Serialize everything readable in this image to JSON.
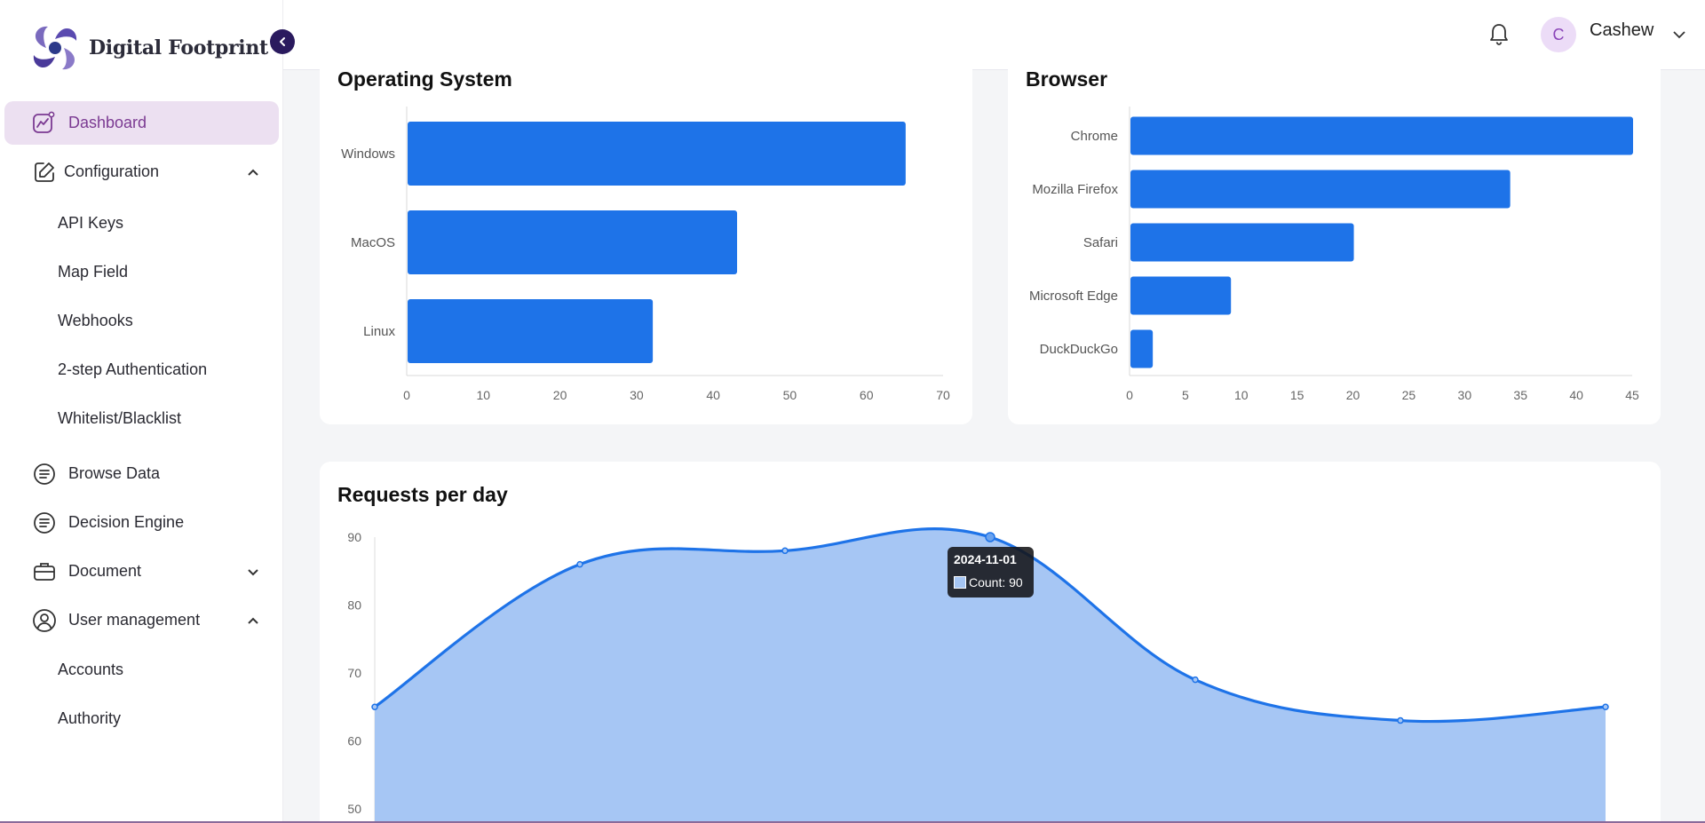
{
  "brand": {
    "name": "Digital Footprint"
  },
  "sidebar": {
    "items": [
      {
        "label": "Dashboard",
        "icon": "chart-line-icon",
        "active": true
      },
      {
        "label": "Configuration",
        "icon": "edit-icon",
        "expanded": true,
        "children": [
          {
            "label": "API Keys"
          },
          {
            "label": "Map Field"
          },
          {
            "label": "Webhooks"
          },
          {
            "label": "2-step Authentication"
          },
          {
            "label": "Whitelist/Blacklist"
          }
        ]
      },
      {
        "label": "Browse Data",
        "icon": "list-icon"
      },
      {
        "label": "Decision Engine",
        "icon": "list-icon"
      },
      {
        "label": "Document",
        "icon": "briefcase-icon",
        "expanded": false
      },
      {
        "label": "User management",
        "icon": "user-circle-icon",
        "expanded": true,
        "children": [
          {
            "label": "Accounts"
          },
          {
            "label": "Authority"
          }
        ]
      }
    ]
  },
  "header": {
    "avatar_initial": "C",
    "username": "Cashew"
  },
  "colors": {
    "accent": "#7b3a92",
    "bar": "#1e73e8",
    "area_fill": "#a6c6f4",
    "line": "#1e73e8"
  },
  "chart_data": [
    {
      "type": "bar",
      "orientation": "horizontal",
      "title": "Operating System",
      "categories": [
        "Windows",
        "MacOS",
        "Linux"
      ],
      "values": [
        65,
        43,
        32
      ],
      "xlim": [
        0,
        70
      ],
      "xticks": [
        0,
        10,
        20,
        30,
        40,
        50,
        60,
        70
      ]
    },
    {
      "type": "bar",
      "orientation": "horizontal",
      "title": "Browser",
      "categories": [
        "Chrome",
        "Mozilla Firefox",
        "Safari",
        "Microsoft Edge",
        "DuckDuckGo"
      ],
      "values": [
        45,
        34,
        20,
        9,
        2
      ],
      "xlim": [
        0,
        45
      ],
      "xticks": [
        0,
        5,
        10,
        15,
        20,
        25,
        30,
        35,
        40,
        45
      ]
    },
    {
      "type": "area",
      "title": "Requests per day",
      "series": [
        {
          "name": "Count",
          "values": [
            65,
            86,
            88,
            90,
            69,
            63,
            65
          ]
        }
      ],
      "ylim": [
        50,
        90
      ],
      "yticks": [
        50,
        60,
        70,
        80,
        90
      ],
      "tooltip": {
        "title": "2024-11-01",
        "label": "Count: 90"
      }
    }
  ]
}
